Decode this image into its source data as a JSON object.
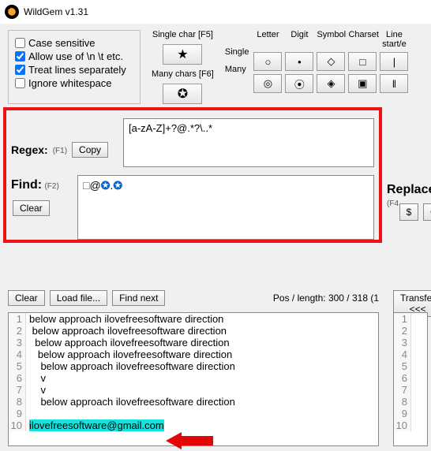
{
  "app": {
    "title": "WildGem v1.31"
  },
  "options": {
    "case_sensitive": "Case sensitive",
    "allow_escapes": "Allow use of \\n \\t etc.",
    "treat_lines": "Treat lines separately",
    "ignore_ws": "Ignore whitespace"
  },
  "shortcuts": {
    "single_label": "Single char [F5]",
    "many_label": "Many chars [F6]"
  },
  "matrix": {
    "col_headers": [
      "Letter",
      "Digit",
      "Symbol",
      "Charset",
      "Line\nstart/e"
    ],
    "row_labels": [
      "Single",
      "Many"
    ],
    "cells_row1": [
      "○",
      "•",
      "◇",
      "□",
      "|"
    ],
    "cells_row2": [
      "◎",
      "⦿",
      "◈",
      "▣",
      "‖"
    ]
  },
  "regex": {
    "label": "Regex:",
    "hint": "(F1)",
    "copy": "Copy",
    "value": "[a-zA-Z]+?@.*?\\..*"
  },
  "find": {
    "label": "Find:",
    "hint": "(F2)",
    "clear": "Clear",
    "token_display": "□@✪.✪"
  },
  "replace": {
    "label": "Replace:",
    "hint": "(F4",
    "dollar": "$",
    "clear": "Clear"
  },
  "midbar": {
    "clear": "Clear",
    "load": "Load file...",
    "find_next": "Find next",
    "pos": "Pos / length: 300 / 318 (1",
    "transfer": "Transfer <<<"
  },
  "editor": {
    "lines": [
      "below approach ilovefreesoftware direction",
      " below approach ilovefreesoftware direction",
      "  below approach ilovefreesoftware direction",
      "   below approach ilovefreesoftware direction",
      "    below approach ilovefreesoftware direction",
      "    v",
      "    v",
      "    below approach ilovefreesoftware direction",
      "",
      "ilovefreesoftware@gmail.com"
    ],
    "highlight_line": 10
  }
}
